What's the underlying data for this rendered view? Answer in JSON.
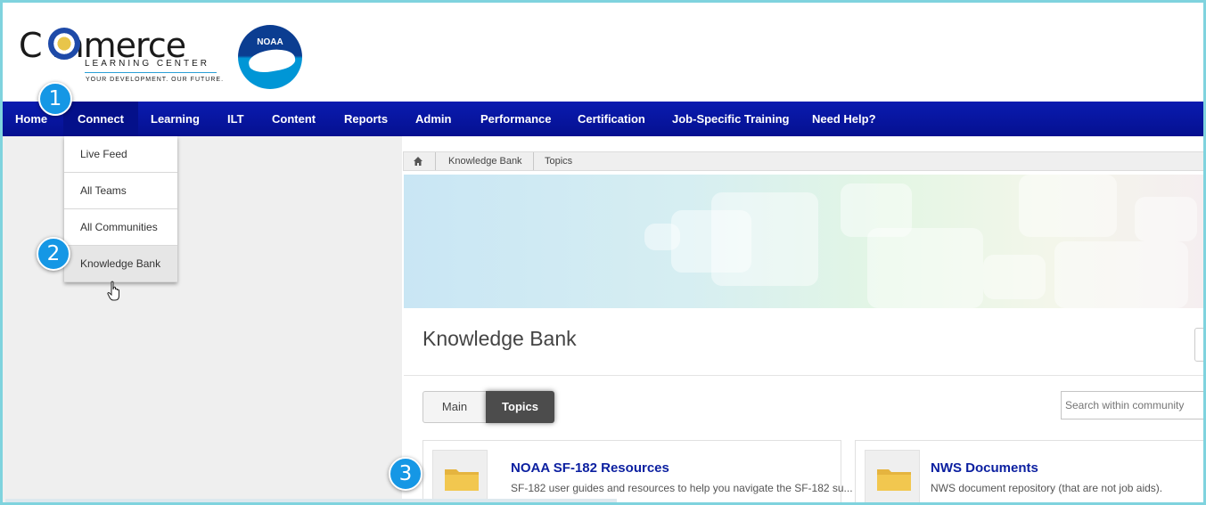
{
  "header": {
    "logo_word": "C mmerce",
    "logo_sub": "LEARNING CENTER",
    "logo_tag": "YOUR DEVELOPMENT. OUR FUTURE.",
    "partner_logo_text": "NOAA"
  },
  "nav": {
    "items": [
      {
        "label": "Home"
      },
      {
        "label": "Connect"
      },
      {
        "label": "Learning"
      },
      {
        "label": "ILT"
      },
      {
        "label": "Content"
      },
      {
        "label": "Reports"
      },
      {
        "label": "Admin"
      },
      {
        "label": "Performance"
      },
      {
        "label": "Certification"
      },
      {
        "label": "Job-Specific Training"
      },
      {
        "label": "Need Help?"
      }
    ],
    "active": "Connect"
  },
  "dropdown": {
    "items": [
      {
        "label": "Live Feed"
      },
      {
        "label": "All Teams"
      },
      {
        "label": "All Communities"
      },
      {
        "label": "Knowledge Bank"
      }
    ],
    "hovered": "Knowledge Bank"
  },
  "callouts": [
    "1",
    "2",
    "3"
  ],
  "breadcrumb": {
    "items": [
      "Knowledge Bank",
      "Topics"
    ]
  },
  "page": {
    "title": "Knowledge Bank"
  },
  "tabs": {
    "main": "Main",
    "topics": "Topics",
    "active": "Topics"
  },
  "search": {
    "placeholder": "Search within community"
  },
  "cards": [
    {
      "title": "NOAA SF-182 Resources",
      "description": "SF-182 user guides and resources to help you navigate the SF-182 su..."
    },
    {
      "title": "NWS Documents",
      "description": "NWS document repository (that are not job aids)."
    }
  ],
  "colors": {
    "nav_bg": "#0a1bb0",
    "callout": "#1597e5",
    "frame_border": "#7fd3de",
    "card_title": "#0b1fa0",
    "folder": "#f2c74f"
  }
}
